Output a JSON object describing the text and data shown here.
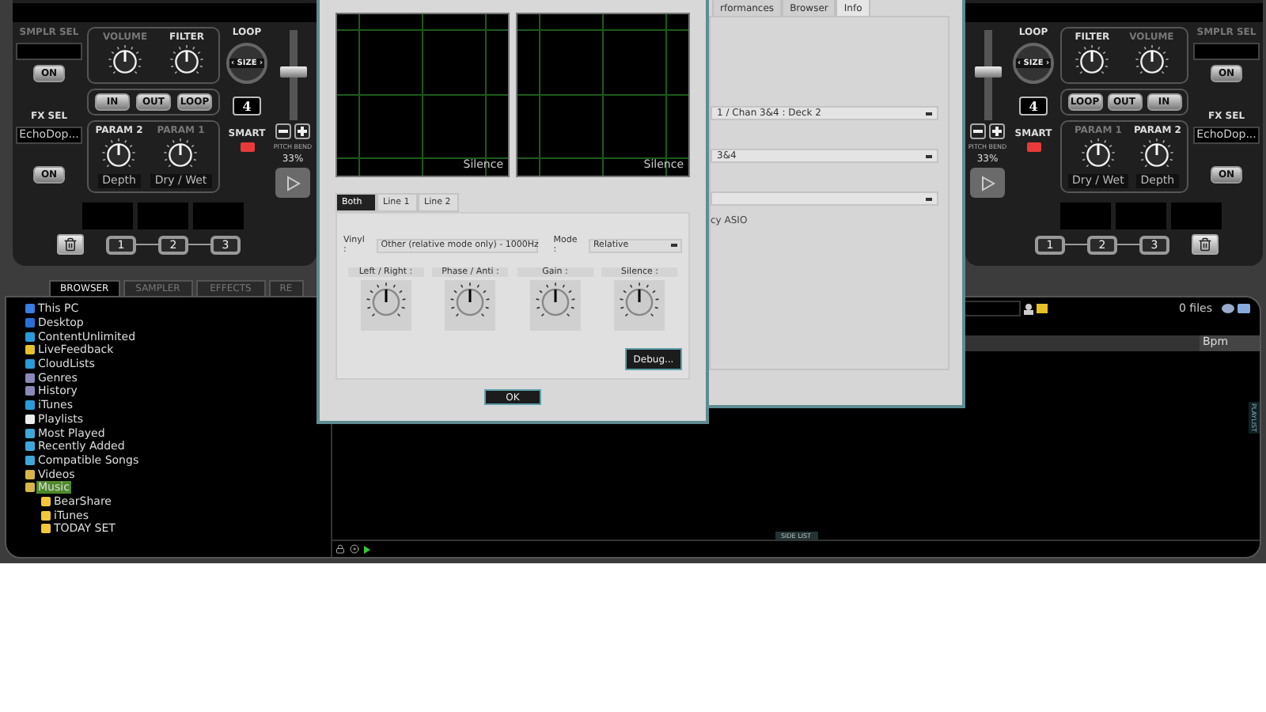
{
  "decks": [
    {
      "kind": "left",
      "sampler": {
        "label": "SMPLR SEL",
        "button": "ON"
      },
      "top_knobs": [
        {
          "label": "VOLUME",
          "active": false
        },
        {
          "label": "FILTER",
          "active": true
        }
      ],
      "loop": {
        "label": "LOOP",
        "size": "‹ SIZE ›",
        "buttons": [
          "IN",
          "OUT",
          "LOOP"
        ],
        "count": "4"
      },
      "smart": {
        "label": "SMART",
        "on": true
      },
      "fx": {
        "label": "FX SEL",
        "value": "EchoDop...",
        "button": "ON"
      },
      "param_knobs": [
        {
          "label": "PARAM 2",
          "active": true,
          "caption": "Depth"
        },
        {
          "label": "PARAM 1",
          "active": false,
          "caption": "Dry / Wet"
        }
      ],
      "hot_cues": [
        "1",
        "2",
        "3"
      ],
      "pitch": {
        "level": 0.55,
        "bend_label": "PITCH BEND",
        "value": "33%"
      }
    },
    {
      "kind": "right",
      "sampler": {
        "label": "SMPLR SEL",
        "button": "ON"
      },
      "top_knobs": [
        {
          "label": "FILTER",
          "active": true
        },
        {
          "label": "VOLUME",
          "active": false
        }
      ],
      "loop": {
        "label": "LOOP",
        "size": "‹ SIZE ›",
        "buttons": [
          "LOOP",
          "OUT",
          "IN"
        ],
        "count": "4"
      },
      "smart": {
        "label": "SMART",
        "on": true
      },
      "fx": {
        "label": "FX SEL",
        "value": "EchoDop...",
        "button": "ON"
      },
      "param_knobs": [
        {
          "label": "PARAM 1",
          "active": false,
          "caption": "Dry / Wet"
        },
        {
          "label": "PARAM 2",
          "active": true,
          "caption": "Depth"
        }
      ],
      "hot_cues": [
        "1",
        "2",
        "3"
      ],
      "pitch": {
        "level": 0.55,
        "bend_label": "PITCH BEND",
        "value": "33%"
      }
    }
  ],
  "settings_dialog": {
    "tabs": [
      {
        "label": "rformances",
        "selected": false
      },
      {
        "label": "Browser",
        "selected": false
      },
      {
        "label": "Info",
        "selected": true
      }
    ],
    "rows": [
      {
        "kind": "select",
        "value": "1 / Chan 3&4 : Deck 2"
      },
      {
        "kind": "select",
        "value": "3&4"
      },
      {
        "kind": "select"
      },
      {
        "kind": "text",
        "value": "cy ASIO"
      }
    ]
  },
  "timecode_dialog": {
    "scopes": [
      {
        "label": "Silence"
      },
      {
        "label": "Silence"
      }
    ],
    "tabs": [
      {
        "label": "Both",
        "selected": true
      },
      {
        "label": "Line 1",
        "selected": false
      },
      {
        "label": "Line 2",
        "selected": false
      }
    ],
    "vinyl": {
      "label": "Vinyl :",
      "value": "Other (relative mode only) - 1000Hz"
    },
    "mode": {
      "label": "Mode :",
      "value": "Relative"
    },
    "knobs": [
      {
        "label": "Left / Right :"
      },
      {
        "label": "Phase / Anti :"
      },
      {
        "label": "Gain :"
      },
      {
        "label": "Silence :"
      }
    ],
    "debug_button": "Debug...",
    "ok_button": "OK"
  },
  "browser": {
    "tabs": [
      {
        "label": "BROWSER",
        "selected": true
      },
      {
        "label": "SAMPLER",
        "selected": false
      },
      {
        "label": "EFFECTS",
        "selected": false
      },
      {
        "label": "RE",
        "selected": false
      }
    ],
    "tree": [
      {
        "label": "This PC",
        "kind": "pc",
        "selected": false
      },
      {
        "label": "Desktop",
        "kind": "desktop",
        "selected": false
      },
      {
        "label": "ContentUnlimited",
        "kind": "net",
        "selected": false
      },
      {
        "label": "LiveFeedback",
        "kind": "feed",
        "selected": false
      },
      {
        "label": "CloudLists",
        "kind": "net",
        "selected": false
      },
      {
        "label": "Genres",
        "kind": "list",
        "selected": false
      },
      {
        "label": "History",
        "kind": "list",
        "selected": false
      },
      {
        "label": "iTunes",
        "kind": "net",
        "selected": false
      },
      {
        "label": "Playlists",
        "kind": "page",
        "selected": false
      },
      {
        "label": "Most Played",
        "kind": "smart",
        "selected": false
      },
      {
        "label": "Recently Added",
        "kind": "smart",
        "selected": false
      },
      {
        "label": "Compatible Songs",
        "kind": "smart",
        "selected": false
      },
      {
        "label": "Videos",
        "kind": "folder",
        "selected": false
      },
      {
        "label": "Music",
        "kind": "folder",
        "selected": true,
        "children": [
          {
            "label": "BearShare",
            "kind": "yfolder",
            "selected": false
          },
          {
            "label": "iTunes",
            "kind": "yfolder",
            "selected": false
          },
          {
            "label": "TODAY SET",
            "kind": "yfolder",
            "selected": false
          }
        ]
      }
    ],
    "file_count": "0 files",
    "columns": [
      {
        "label": "Bpm"
      }
    ],
    "side_list": "SIDE LIST",
    "side_tab": "PLAYLIST"
  }
}
